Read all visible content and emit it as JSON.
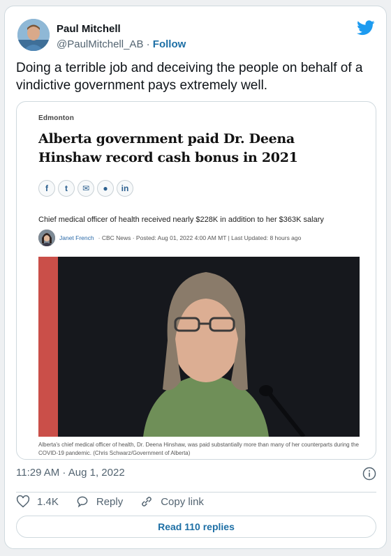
{
  "tweet": {
    "author_name": "Paul Mitchell",
    "handle": "@PaulMitchell_AB",
    "separator": "·",
    "follow_label": "Follow",
    "text": "Doing a terrible job and deceiving the people on behalf of a vindictive government pays extremely well.",
    "timestamp": "11:29 AM · Aug 1, 2022",
    "likes": "1.4K",
    "reply_label": "Reply",
    "copy_link_label": "Copy link",
    "read_replies_label": "Read 110 replies",
    "brand_color": "#1d9bf0"
  },
  "article": {
    "section": "Edmonton",
    "headline": "Alberta government paid Dr. Deena Hinshaw record cash bonus in 2021",
    "share_icons": [
      {
        "name": "facebook-icon",
        "glyph": "f"
      },
      {
        "name": "twitter-icon",
        "glyph": "t"
      },
      {
        "name": "email-icon",
        "glyph": "✉"
      },
      {
        "name": "reddit-icon",
        "glyph": "●"
      },
      {
        "name": "linkedin-icon",
        "glyph": "in"
      }
    ],
    "deck": "Chief medical officer of health received nearly $228K in addition to her $363K salary",
    "author": "Janet French",
    "meta": "· CBC News · Posted: Aug 01, 2022 4:00 AM MT | Last Updated: 8 hours ago",
    "caption": "Alberta's chief medical officer of health, Dr. Deena Hinshaw, was paid substantially more than many of her counterparts during the COVID-19 pandemic. (Chris Schwarz/Government of Alberta)"
  }
}
